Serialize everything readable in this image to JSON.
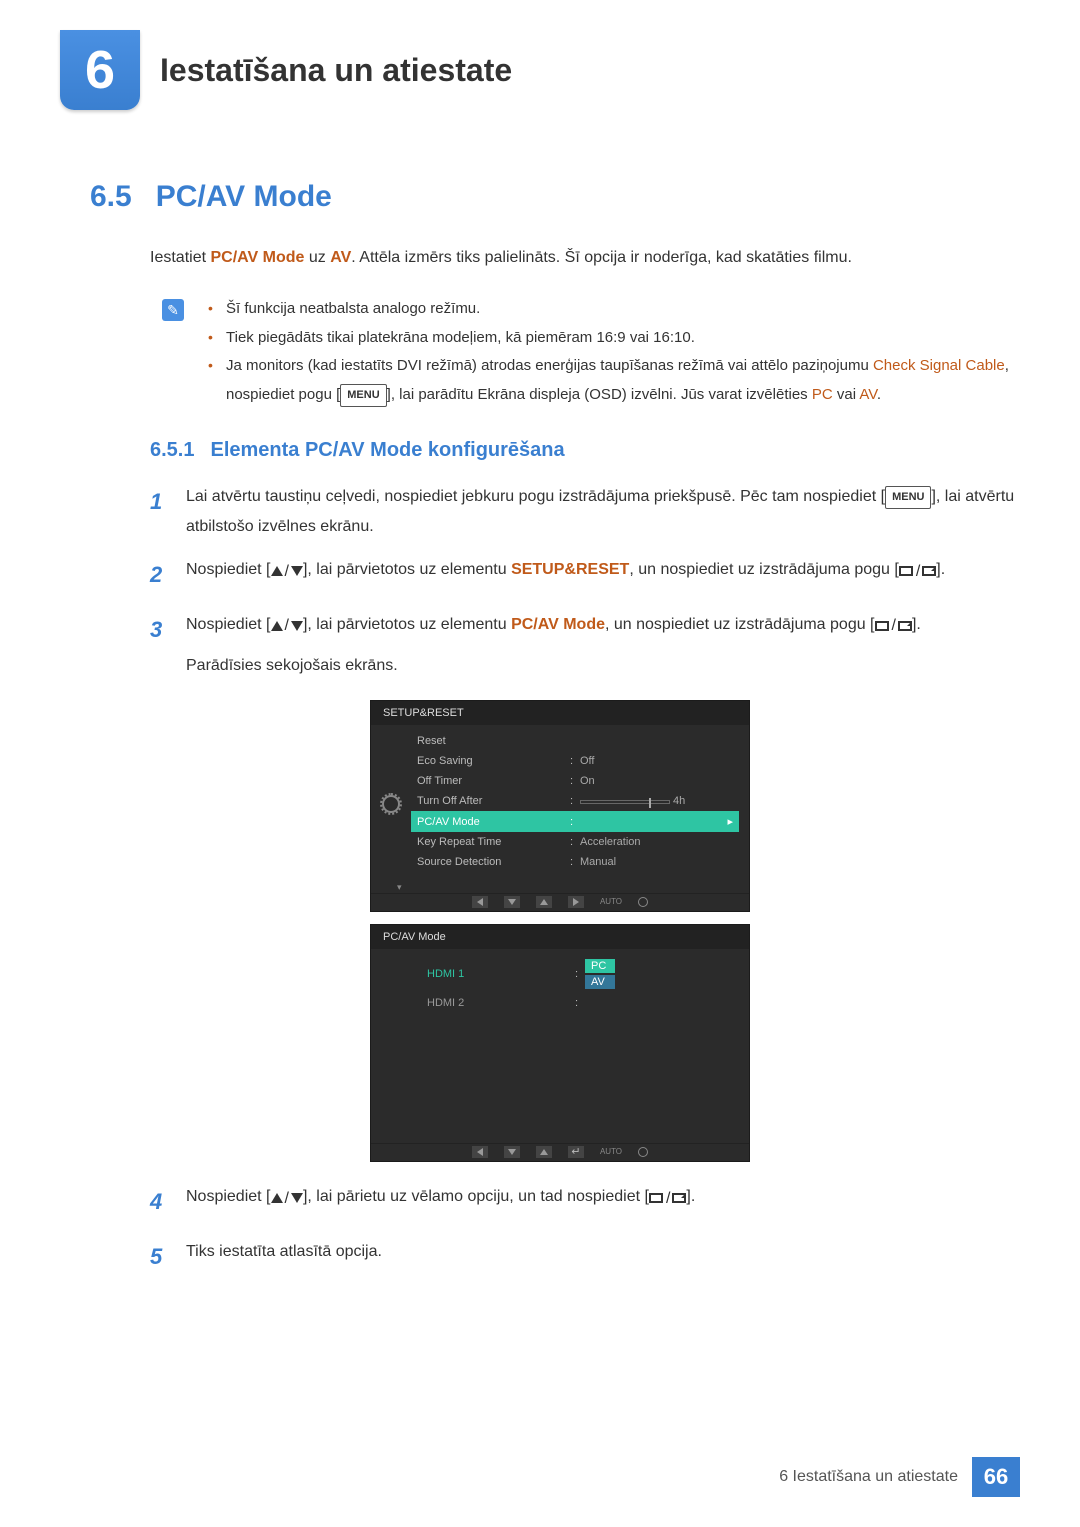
{
  "header": {
    "chapter_number": "6",
    "chapter_title": "Iestatīšana un atiestate"
  },
  "section": {
    "number": "6.5",
    "title": "PC/AV Mode",
    "intro_pre": "Iestatiet ",
    "intro_hl1": "PC/AV Mode",
    "intro_mid": " uz ",
    "intro_hl2": "AV",
    "intro_post": ". Attēla izmērs tiks palielināts. Šī opcija ir noderīga, kad skatāties filmu."
  },
  "notes": {
    "n1": "Šī funkcija neatbalsta analogo režīmu.",
    "n2": "Tiek piegādāts tikai platekrāna modeļiem, kā piemēram 16:9 vai 16:10.",
    "n3_a": "Ja monitors (kad iestatīts DVI režīmā) atrodas enerģijas taupīšanas režīmā vai attēlo paziņojumu ",
    "n3_hl1": "Check Signal Cable",
    "n3_b": ", nospiediet pogu [",
    "n3_menu": "MENU",
    "n3_c": "], lai parādītu Ekrāna displeja (OSD) izvēlni. Jūs varat izvēlēties ",
    "n3_hl2": "PC",
    "n3_or": " vai ",
    "n3_hl3": "AV",
    "n3_end": "."
  },
  "subsection": {
    "number": "6.5.1",
    "title": "Elementa PC/AV Mode konfigurēšana"
  },
  "steps": {
    "s1_num": "1",
    "s1_a": "Lai atvērtu taustiņu ceļvedi, nospiediet jebkuru pogu izstrādājuma priekšpusē. Pēc tam nospiediet [",
    "s1_menu": "MENU",
    "s1_b": "], lai atvērtu atbilstošo izvēlnes ekrānu.",
    "s2_num": "2",
    "s2_a": "Nospiediet [",
    "s2_b": "], lai pārvietotos uz elementu ",
    "s2_hl": "SETUP&RESET",
    "s2_c": ", un nospiediet uz izstrādājuma pogu [",
    "s2_d": "].",
    "s3_num": "3",
    "s3_a": "Nospiediet [",
    "s3_b": "], lai pārvietotos uz elementu ",
    "s3_hl": "PC/AV Mode",
    "s3_c": ", un nospiediet uz izstrādājuma pogu [",
    "s3_d": "].",
    "s3_e": "Parādīsies sekojošais ekrāns.",
    "s4_num": "4",
    "s4_a": "Nospiediet [",
    "s4_b": "], lai pārietu uz vēlamo opciju, un tad nospiediet [",
    "s4_c": "].",
    "s5_num": "5",
    "s5_a": "Tiks iestatīta atlasītā opcija."
  },
  "osd1": {
    "title": "SETUP&RESET",
    "rows": [
      {
        "label": "Reset",
        "value": ""
      },
      {
        "label": "Eco Saving",
        "value": "Off"
      },
      {
        "label": "Off Timer",
        "value": "On"
      },
      {
        "label": "Turn Off After",
        "value": "4h",
        "slider": true
      },
      {
        "label": "PC/AV Mode",
        "value": "",
        "selected": true,
        "arrow": true
      },
      {
        "label": "Key Repeat Time",
        "value": "Acceleration"
      },
      {
        "label": "Source Detection",
        "value": "Manual"
      }
    ],
    "auto": "AUTO"
  },
  "osd2": {
    "title": "PC/AV Mode",
    "rows": [
      {
        "label": "HDMI 1",
        "value": "PC",
        "value2": "AV",
        "active": true
      },
      {
        "label": "HDMI 2",
        "value": ""
      }
    ],
    "auto": "AUTO"
  },
  "footer": {
    "chapter_label": "6 Iestatīšana un atiestate",
    "page": "66"
  }
}
